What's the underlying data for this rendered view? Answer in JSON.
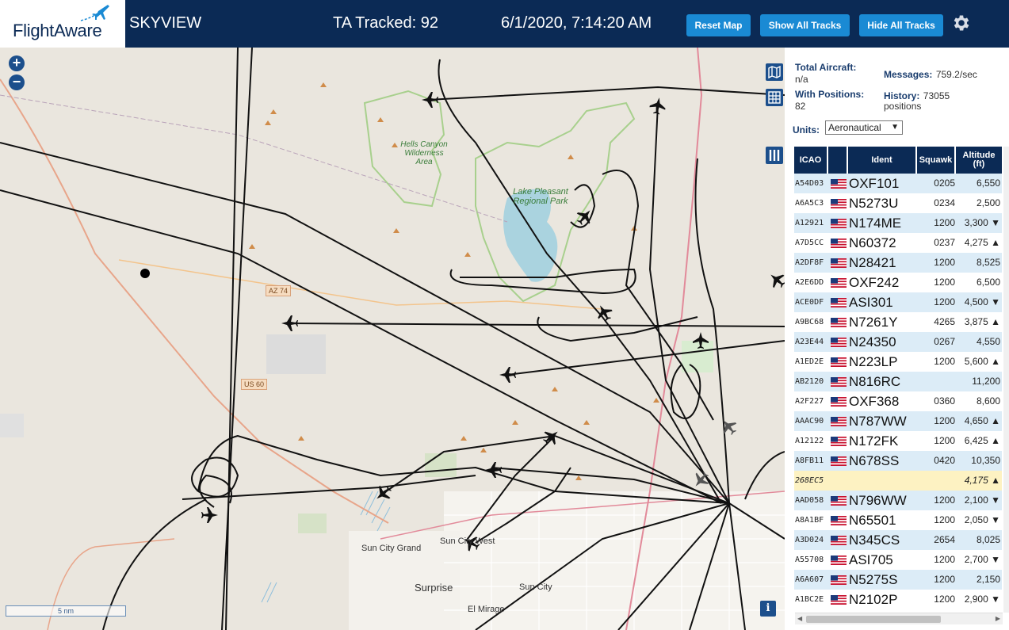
{
  "header": {
    "logo_text": "FlightAware",
    "app_name": "SKYVIEW",
    "tracked": "TA Tracked: 92",
    "clock": "6/1/2020, 7:14:20 AM",
    "buttons": {
      "reset": "Reset Map",
      "show": "Show All Tracks",
      "hide": "Hide All Tracks"
    }
  },
  "map": {
    "zoom_in": "+",
    "zoom_out": "−",
    "scale": "5 nm",
    "info": "i",
    "places": {
      "sun_city_grand": "Sun City Grand",
      "sun_city_west": "Sun City West",
      "surprise": "Surprise",
      "sun_city": "Sun City",
      "el_mirage": "El Mirage",
      "hells_canyon": "Hells Canyon Wilderness Area",
      "lake_pleasant": "Lake Pleasant Regional Park"
    },
    "roads": {
      "az74": "AZ 74",
      "us60": "US 60"
    }
  },
  "sidebar": {
    "total_aircraft_label": "Total Aircraft:",
    "total_aircraft_value": "n/a",
    "with_positions_label": "With Positions:",
    "with_positions_value": "82",
    "messages_label": "Messages:",
    "messages_value": "759.2/sec",
    "history_label": "History:",
    "history_value": "73055",
    "history_unit": "positions",
    "units_label": "Units:",
    "units_value": "Aeronautical",
    "columns": {
      "icao": "ICAO",
      "ident": "Ident",
      "squawk": "Squawk",
      "altitude": "Altitude (ft)"
    },
    "rows": [
      {
        "icao": "A54D03",
        "ident": "OXF101",
        "squawk": "0205",
        "alt": "6,550"
      },
      {
        "icao": "A6A5C3",
        "ident": "N5273U",
        "squawk": "0234",
        "alt": "2,500"
      },
      {
        "icao": "A12921",
        "ident": "N174ME",
        "squawk": "1200",
        "alt": "3,300 ▼"
      },
      {
        "icao": "A7D5CC",
        "ident": "N60372",
        "squawk": "0237",
        "alt": "4,275 ▲"
      },
      {
        "icao": "A2DF8F",
        "ident": "N28421",
        "squawk": "1200",
        "alt": "8,525"
      },
      {
        "icao": "A2E6DD",
        "ident": "OXF242",
        "squawk": "1200",
        "alt": "6,500"
      },
      {
        "icao": "ACE0DF",
        "ident": "ASI301",
        "squawk": "1200",
        "alt": "4,500 ▼"
      },
      {
        "icao": "A9BC68",
        "ident": "N7261Y",
        "squawk": "4265",
        "alt": "3,875 ▲"
      },
      {
        "icao": "A23E44",
        "ident": "N24350",
        "squawk": "0267",
        "alt": "4,550"
      },
      {
        "icao": "A1ED2E",
        "ident": "N223LP",
        "squawk": "1200",
        "alt": "5,600 ▲"
      },
      {
        "icao": "AB2120",
        "ident": "N816RC",
        "squawk": "",
        "alt": "11,200"
      },
      {
        "icao": "A2F227",
        "ident": "OXF368",
        "squawk": "0360",
        "alt": "8,600"
      },
      {
        "icao": "AAAC90",
        "ident": "N787WW",
        "squawk": "1200",
        "alt": "4,650 ▲"
      },
      {
        "icao": "A12122",
        "ident": "N172FK",
        "squawk": "1200",
        "alt": "6,425 ▲"
      },
      {
        "icao": "A8FB11",
        "ident": "N678SS",
        "squawk": "0420",
        "alt": "10,350"
      },
      {
        "icao": "268EC5",
        "ident": "",
        "squawk": "",
        "alt": "4,175 ▲",
        "selected": true
      },
      {
        "icao": "AAD058",
        "ident": "N796WW",
        "squawk": "1200",
        "alt": "2,100 ▼"
      },
      {
        "icao": "A8A1BF",
        "ident": "N65501",
        "squawk": "1200",
        "alt": "2,050 ▼"
      },
      {
        "icao": "A3D024",
        "ident": "N345CS",
        "squawk": "2654",
        "alt": "8,025"
      },
      {
        "icao": "A55708",
        "ident": "ASI705",
        "squawk": "1200",
        "alt": "2,700 ▼"
      },
      {
        "icao": "A6A607",
        "ident": "N5275S",
        "squawk": "1200",
        "alt": "2,150"
      },
      {
        "icao": "A1BC2E",
        "ident": "N2102P",
        "squawk": "1200",
        "alt": "2,900 ▼"
      }
    ]
  },
  "colors": {
    "header_bg": "#0b2a55",
    "button_bg": "#1a8ad4",
    "row_alt": "#dcecf7",
    "row_selected": "#fdf2c2",
    "track": "#111111"
  }
}
